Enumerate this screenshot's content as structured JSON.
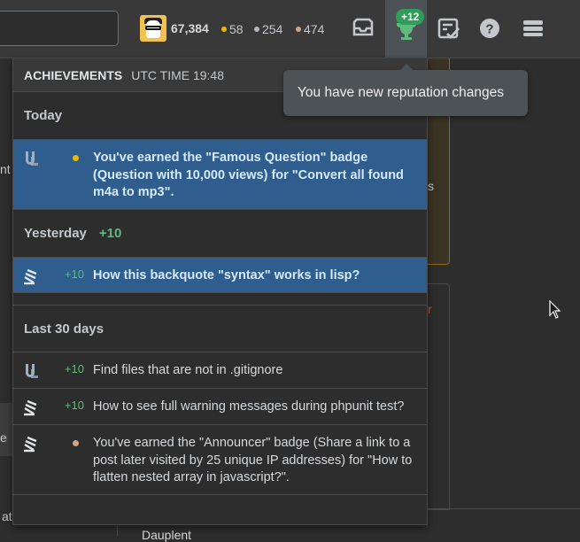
{
  "topbar": {
    "reputation": "67,384",
    "gold_count": "58",
    "silver_count": "254",
    "bronze_count": "474",
    "achievements_delta": "+12",
    "icons": [
      "inbox-icon",
      "achievements-trophy-icon",
      "review-queue-icon",
      "help-icon",
      "site-switcher-icon"
    ]
  },
  "background": {
    "left_fragment_1": "nt",
    "left_fragment_2": "e",
    "left_fragment_3": "at",
    "right_fragment_1": "s",
    "right_fragment_2": "r",
    "bottom_fragment": "Dauplent"
  },
  "achievements": {
    "title": "ACHIEVEMENTS",
    "time_label": "UTC TIME 19:48",
    "sections": {
      "today": {
        "label": "Today"
      },
      "yesterday": {
        "label": "Yesterday",
        "delta": "+10"
      },
      "last30": {
        "label": "Last 30 days"
      }
    },
    "items": [
      {
        "icon": "unix-linux-site-icon",
        "rep": "",
        "badge": "gold",
        "text": "You've earned the \"Famous Question\" badge (Question with 10,000 views) for \"Convert all found m4a to mp3\"."
      },
      {
        "icon": "stack-overflow-site-icon",
        "rep": "+10",
        "badge": "",
        "text": "How this backquote \"syntax\" works in lisp?"
      },
      {
        "icon": "unix-linux-site-icon",
        "rep": "+10",
        "badge": "",
        "text": "Find files that are not in .gitignore"
      },
      {
        "icon": "stack-overflow-site-icon",
        "rep": "+10",
        "badge": "",
        "text": "How to see full warning messages during phpunit test?"
      },
      {
        "icon": "stack-overflow-site-icon",
        "rep": "",
        "badge": "bronze",
        "text": "You've earned the \"Announcer\" badge (Share a link to a post later visited by 25 unique IP addresses) for \"How to flatten nested array in javascript?\"."
      }
    ]
  },
  "tooltip": {
    "text": "You have new reputation changes"
  },
  "colors": {
    "gold": "#f1b600",
    "silver": "#b4b8bc",
    "bronze": "#d1a684",
    "rep_green": "#5eba7d",
    "highlight": "#2e5d8e"
  }
}
